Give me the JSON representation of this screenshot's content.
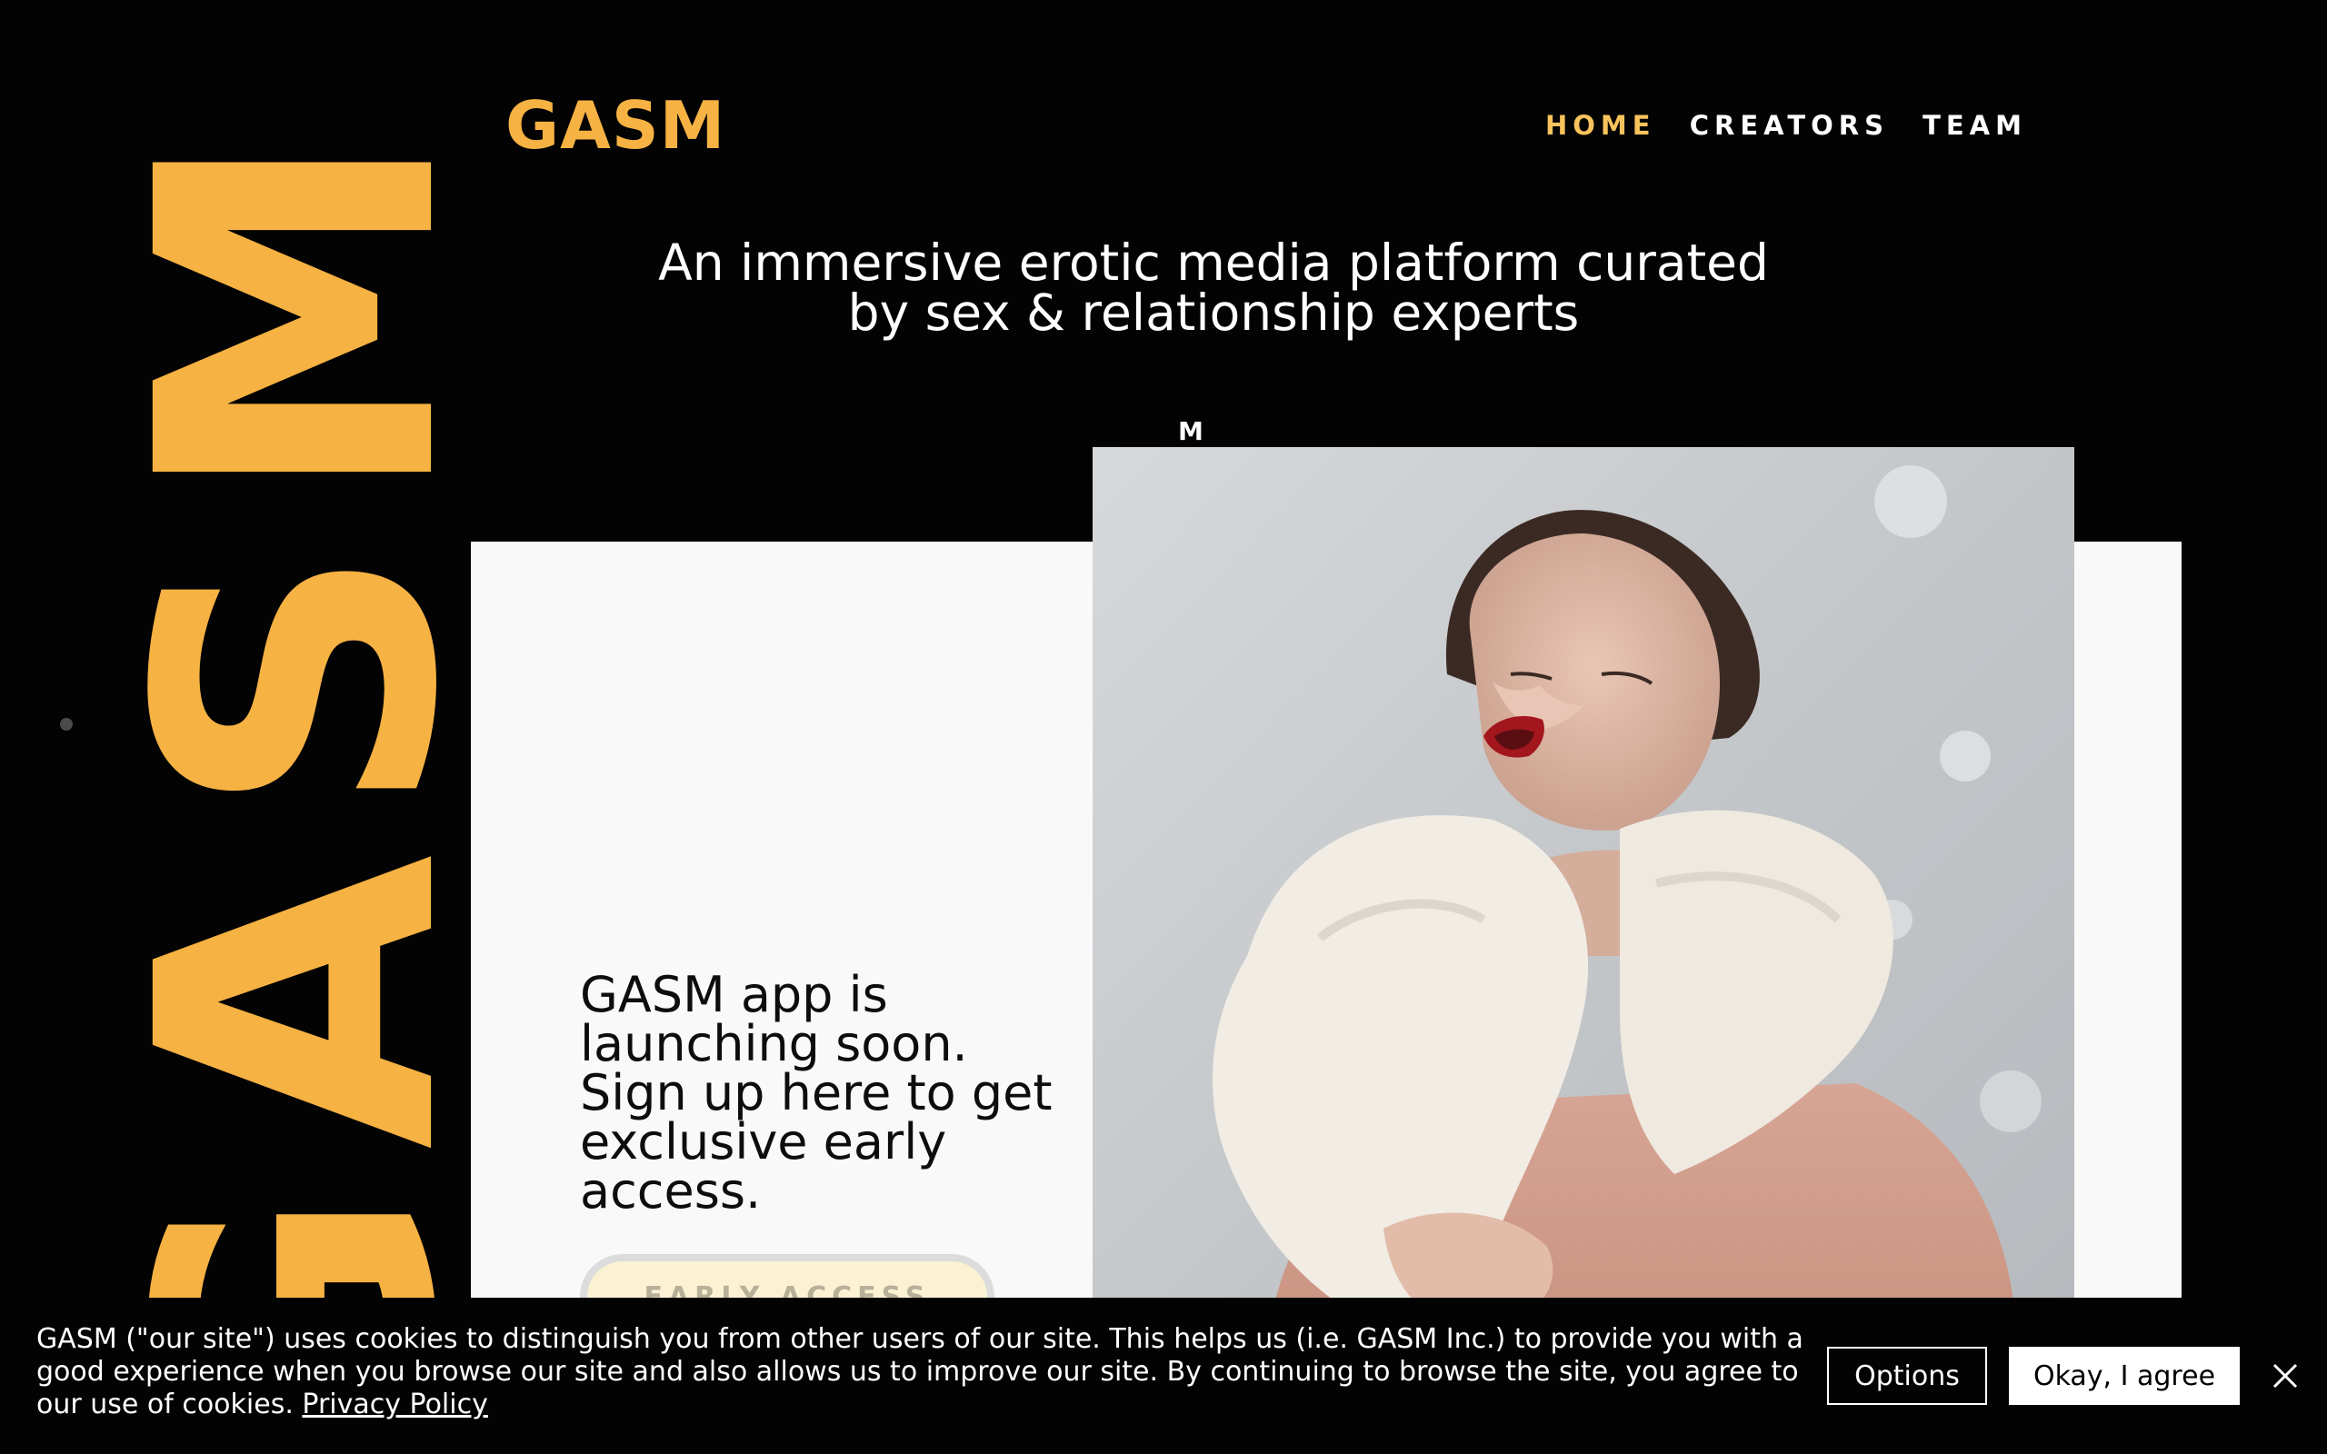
{
  "brand": {
    "logo": "GASM",
    "side_wordmark": "GASM",
    "accent_color": "#f6b243",
    "nav_active_color": "#f8c35c"
  },
  "nav": {
    "items": [
      {
        "label": "HOME",
        "active": true
      },
      {
        "label": "CREATORS",
        "active": false
      },
      {
        "label": "TEAM",
        "active": false
      }
    ]
  },
  "hero": {
    "tagline_line1": "An immersive erotic media platform curated",
    "tagline_line2": "by sex & relationship experts",
    "floating_glyph": "M",
    "launch_lines": [
      "GASM app is",
      "launching soon.",
      "Sign up here to get",
      "exclusive early",
      "access."
    ],
    "cta_label": "EARLY ACCESS"
  },
  "cookie_banner": {
    "text": "GASM (\"our site\") uses cookies to distinguish you from other users of our site. This helps us (i.e. GASM Inc.) to provide you with a good experience when you browse our site and also allows us to improve our site. By continuing to browse the site, you agree to our use of cookies.",
    "policy_link": "Privacy Policy",
    "options_label": "Options",
    "agree_label": "Okay, I agree",
    "close_icon": "close-icon"
  }
}
